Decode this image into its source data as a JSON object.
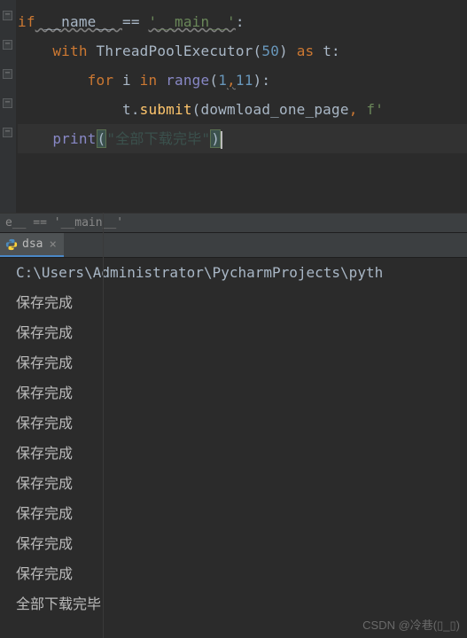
{
  "editor": {
    "lines": {
      "l1_if": "if",
      "l1_name": " __name__ ",
      "l1_eq": "== ",
      "l1_str": "'__main__'",
      "l1_colon": ":",
      "l2_with": "with",
      "l2_exec": " ThreadPoolExecutor",
      "l2_p1": "(",
      "l2_num": "50",
      "l2_p2": ") ",
      "l2_as": "as",
      "l2_t": " t",
      "l2_colon": ":",
      "l3_for": "for",
      "l3_i": " i ",
      "l3_in": "in",
      "l3_range": " range",
      "l3_p1": "(",
      "l3_n1": "1",
      "l3_c1": ",",
      "l3_n2": "11",
      "l3_p2": ")",
      "l3_colon": ":",
      "l4_t": "t.",
      "l4_submit": "submit",
      "l4_p1": "(",
      "l4_func": "dowmload_one_page",
      "l4_c1": ", ",
      "l4_f": "f'",
      "l5_print": "print",
      "l5_p1": "(",
      "l5_str": "\"全部下载完毕\"",
      "l5_p2": ")"
    },
    "indent1": "    ",
    "indent2": "        ",
    "indent3": "            "
  },
  "breadcrumb": {
    "text": "e__ == '__main__'"
  },
  "tab": {
    "label": "dsa"
  },
  "console": {
    "path": "C:\\Users\\Administrator\\PycharmProjects\\pyth",
    "save_msg": "保存完成",
    "final_msg": "全部下载完毕"
  },
  "watermark": {
    "text": "CSDN @冷巷(▯_▯)"
  }
}
